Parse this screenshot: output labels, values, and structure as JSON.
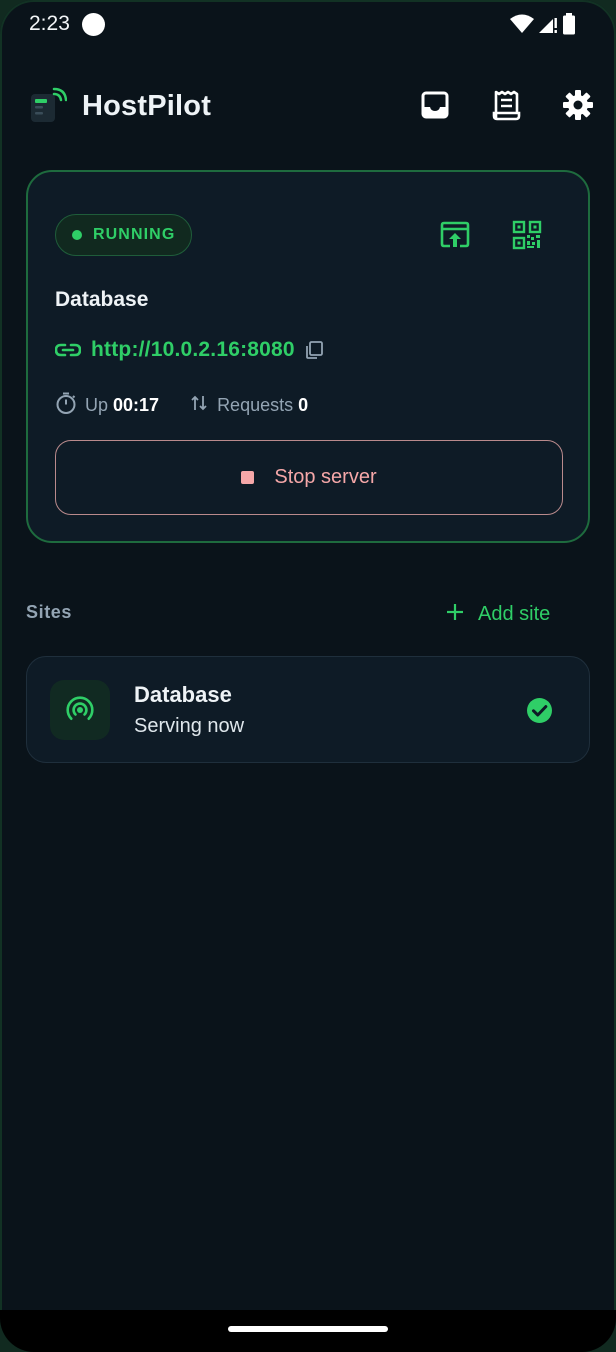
{
  "status_bar": {
    "time": "2:23"
  },
  "app_bar": {
    "title": "HostPilot",
    "actions": [
      {
        "icon": "inbox-icon"
      },
      {
        "icon": "receipt-icon"
      },
      {
        "icon": "gear-icon"
      }
    ]
  },
  "server": {
    "status": "RUNNING",
    "site_name": "Database",
    "url": "http://10.0.2.16:8080",
    "uptime_label": "Up",
    "uptime_value": "00:17",
    "requests_label": "Requests",
    "requests_value": "0",
    "stop_label": "Stop server"
  },
  "sites": {
    "header": "Sites",
    "add_label": "Add site",
    "items": [
      {
        "title": "Database",
        "subtitle": "Serving now",
        "active": true
      }
    ]
  },
  "colors": {
    "accent": "#2fce67",
    "background": "#0a131a",
    "card": "#0e1b26",
    "danger": "#f5a7a8",
    "muted": "#93a4b3"
  }
}
